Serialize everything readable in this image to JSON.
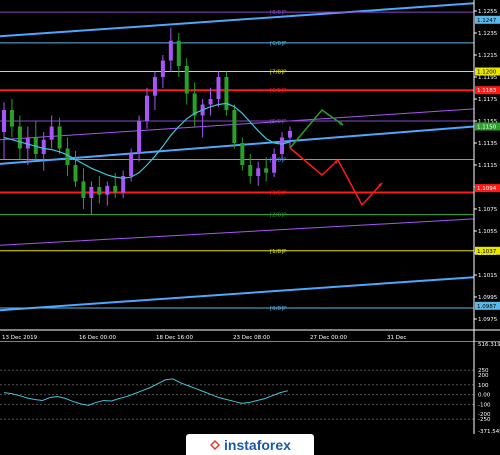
{
  "chart_data": [
    {
      "type": "candlestick",
      "title": "",
      "y_ticks": [
        "1.1255",
        "1.1235",
        "1.1215",
        "1.1195",
        "1.1175",
        "1.1155",
        "1.1135",
        "1.1115",
        "1.1095",
        "1.1075",
        "1.1055",
        "1.1035",
        "1.1015",
        "1.0995",
        "1.0975"
      ],
      "ylim": [
        1.0965,
        1.1265
      ],
      "x_ticks": [
        "13 Dec 2019",
        "16 Dec 00:00",
        "18 Dec 16:00",
        "23 Dec 08:00",
        "27 Dec 00:00",
        "31 Dec"
      ],
      "murrey_levels": [
        {
          "label": "[8/8]P",
          "price": 1.1254,
          "color": "#8a48c8"
        },
        {
          "label": "[6/8]P",
          "price": 1.1226,
          "color": "#5bb8e8"
        },
        {
          "label": "[7/8]P",
          "price": 1.12,
          "color": "#e6e600"
        },
        {
          "label": "[6/8]P",
          "price": 1.1183,
          "color": "#ff1a1a"
        },
        {
          "label": "[5/8]P",
          "price": 1.1155,
          "color": "#8a48c8"
        },
        {
          "label": "[4/8]P",
          "price": 1.112,
          "color": "#4ea6ff"
        },
        {
          "label": "[3/8]P",
          "price": 1.109,
          "color": "#ff1a1a"
        },
        {
          "label": "[2/8]P",
          "price": 1.107,
          "color": "#2aa02a"
        },
        {
          "label": "[1/8]P",
          "price": 1.1037,
          "color": "#e6e600"
        },
        {
          "label": "[0/8]P",
          "price": 1.0985,
          "color": "#5bb8e8"
        }
      ],
      "price_tags": [
        {
          "value": "1.1247",
          "bg": "#5bb8e8",
          "fg": "#000000"
        },
        {
          "value": "1.1200",
          "bg": "#e6e600",
          "fg": "#000000"
        },
        {
          "value": "1.1183",
          "bg": "#ff1a1a",
          "fg": "#ffffff"
        },
        {
          "value": "1.1150",
          "bg": "#2aa02a",
          "fg": "#ffffff"
        },
        {
          "value": "1.1094",
          "bg": "#ff1a1a",
          "fg": "#ffffff"
        },
        {
          "value": "1.1037",
          "bg": "#e6e600",
          "fg": "#000000"
        },
        {
          "value": "1.0987",
          "bg": "#5bb8e8",
          "fg": "#000000"
        }
      ],
      "candles": [
        [
          1.1145,
          1.1172,
          1.112,
          1.1165
        ],
        [
          1.1165,
          1.1175,
          1.114,
          1.115
        ],
        [
          1.115,
          1.116,
          1.112,
          1.113
        ],
        [
          1.113,
          1.115,
          1.1115,
          1.114
        ],
        [
          1.114,
          1.1155,
          1.112,
          1.1125
        ],
        [
          1.1125,
          1.1145,
          1.111,
          1.1138
        ],
        [
          1.1138,
          1.116,
          1.113,
          1.115
        ],
        [
          1.115,
          1.1158,
          1.1125,
          1.113
        ],
        [
          1.113,
          1.114,
          1.1105,
          1.1115
        ],
        [
          1.1115,
          1.1128,
          1.1095,
          1.11
        ],
        [
          1.11,
          1.1112,
          1.1075,
          1.1085
        ],
        [
          1.1085,
          1.11,
          1.107,
          1.1095
        ],
        [
          1.1095,
          1.1105,
          1.108,
          1.1088
        ],
        [
          1.1088,
          1.11,
          1.1078,
          1.1096
        ],
        [
          1.1096,
          1.1108,
          1.1085,
          1.109
        ],
        [
          1.109,
          1.111,
          1.1085,
          1.1105
        ],
        [
          1.1105,
          1.113,
          1.11,
          1.1125
        ],
        [
          1.1125,
          1.116,
          1.1118,
          1.1155
        ],
        [
          1.1155,
          1.1185,
          1.1148,
          1.1178
        ],
        [
          1.1178,
          1.12,
          1.1165,
          1.1195
        ],
        [
          1.1195,
          1.1215,
          1.1185,
          1.121
        ],
        [
          1.121,
          1.124,
          1.12,
          1.1228
        ],
        [
          1.1228,
          1.1235,
          1.1195,
          1.1205
        ],
        [
          1.1205,
          1.1212,
          1.117,
          1.118
        ],
        [
          1.118,
          1.119,
          1.115,
          1.116
        ],
        [
          1.116,
          1.1175,
          1.114,
          1.117
        ],
        [
          1.117,
          1.1185,
          1.116,
          1.1175
        ],
        [
          1.1175,
          1.12,
          1.1168,
          1.1195
        ],
        [
          1.1195,
          1.12,
          1.116,
          1.1165
        ],
        [
          1.1165,
          1.117,
          1.113,
          1.1135
        ],
        [
          1.1135,
          1.114,
          1.111,
          1.1115
        ],
        [
          1.1115,
          1.1125,
          1.1098,
          1.1105
        ],
        [
          1.1105,
          1.1118,
          1.1096,
          1.1112
        ],
        [
          1.1112,
          1.1122,
          1.11,
          1.1108
        ],
        [
          1.1108,
          1.113,
          1.1104,
          1.1125
        ],
        [
          1.1125,
          1.1145,
          1.112,
          1.114
        ],
        [
          1.114,
          1.115,
          1.113,
          1.1146
        ]
      ],
      "ma_series": [
        1.114,
        1.1138,
        1.1136,
        1.1134,
        1.1132,
        1.113,
        1.1129,
        1.1127,
        1.1124,
        1.112,
        1.1116,
        1.1112,
        1.1109,
        1.1106,
        1.1104,
        1.1103,
        1.1104,
        1.1108,
        1.1115,
        1.1123,
        1.1132,
        1.1142,
        1.115,
        1.1157,
        1.1162,
        1.1165,
        1.1168,
        1.117,
        1.1171,
        1.1168,
        1.1162,
        1.1154,
        1.1146,
        1.1139,
        1.1135,
        1.1134,
        1.1136
      ],
      "trend_channel": {
        "upper_start": 1.1232,
        "upper_end": 1.1262,
        "lower_start": 1.1116,
        "lower_end": 1.115
      }
    },
    {
      "type": "line",
      "title": "",
      "y_ticks": [
        "516.3192",
        "250",
        "200",
        "100",
        "0.00",
        "-100",
        "-200",
        "-250",
        "-371.5495"
      ],
      "ylim": [
        -371.5495,
        516.3192
      ],
      "values": [
        20,
        10,
        -10,
        -35,
        -50,
        -60,
        -30,
        -20,
        -40,
        -70,
        -95,
        -110,
        -80,
        -60,
        -65,
        -40,
        -20,
        10,
        40,
        70,
        110,
        150,
        160,
        120,
        90,
        60,
        30,
        0,
        -30,
        -50,
        -70,
        -90,
        -80,
        -60,
        -40,
        -10,
        20,
        40
      ]
    }
  ],
  "logo": {
    "text": "instaforex"
  }
}
